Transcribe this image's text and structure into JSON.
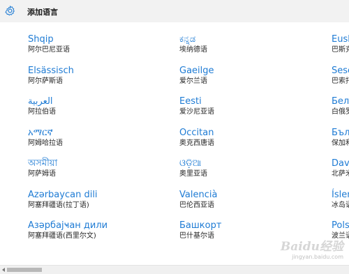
{
  "header": {
    "icon": "gear-icon",
    "title": "添加语言"
  },
  "columns": [
    [
      {
        "name": "Shqip",
        "sub": "阿尔巴尼亚语"
      },
      {
        "name": "Elsässisch",
        "sub": "阿尔萨斯语"
      },
      {
        "name": "العربية",
        "sub": "阿拉伯语"
      },
      {
        "name": "አማርኛ",
        "sub": "阿姆哈拉语"
      },
      {
        "name": "অসমীয়া",
        "sub": "阿萨姆语"
      },
      {
        "name": "Azərbaycan dili",
        "sub": "阿塞拜疆语(拉丁语)"
      },
      {
        "name": "Азәрбајҹан дили",
        "sub": "阿塞拜疆语(西里尔文)"
      }
    ],
    [
      {
        "name": "ಕನ್ನಡ",
        "sub": "埃纳德语"
      },
      {
        "name": "Gaeilge",
        "sub": "爱尔兰语"
      },
      {
        "name": "Eesti",
        "sub": "爱沙尼亚语"
      },
      {
        "name": "Occitan",
        "sub": "奥克西唐语"
      },
      {
        "name": "ଓଡ଼ିଆ",
        "sub": "奥里亚语"
      },
      {
        "name": "Valencià",
        "sub": "巴伦西亚语"
      },
      {
        "name": "Башкорт",
        "sub": "巴什基尔语"
      }
    ],
    [
      {
        "name": "Eusk",
        "sub": "巴斯克"
      },
      {
        "name": "Sesc",
        "sub": "巴索托"
      },
      {
        "name": "Бела",
        "sub": "白俄罗"
      },
      {
        "name": "Бъл",
        "sub": "保加利"
      },
      {
        "name": "Dav",
        "sub": "北萨米"
      },
      {
        "name": "Íslen",
        "sub": "冰岛语"
      },
      {
        "name": "Pols",
        "sub": "波兰语"
      }
    ]
  ],
  "watermark": {
    "main": "Baidu经验",
    "sub": "jingyan.baidu.com"
  },
  "scrollbar": {
    "position_fraction": 0.02
  }
}
